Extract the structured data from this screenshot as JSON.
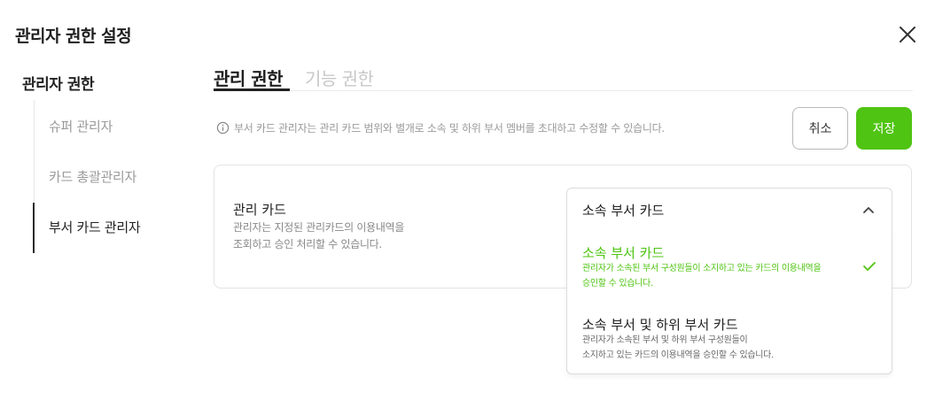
{
  "page": {
    "title": "관리자 권한 설정"
  },
  "sidebar": {
    "title": "관리자 권한",
    "items": [
      {
        "label": "슈퍼 관리자",
        "active": false
      },
      {
        "label": "카드 총괄관리자",
        "active": false
      },
      {
        "label": "부서 카드 관리자",
        "active": true
      }
    ]
  },
  "tabs": [
    {
      "label": "관리 권한",
      "active": true
    },
    {
      "label": "기능 권한",
      "active": false
    }
  ],
  "info": {
    "text": "부서 카드 관리자는 관리 카드 범위와 별개로 소속 및 하위 부서 멤버를 초대하고 수정할 수 있습니다."
  },
  "actions": {
    "cancel_label": "취소",
    "save_label": "저장"
  },
  "card": {
    "title": "관리 카드",
    "desc_line1": "관리자는 지정된 관리카드의 이용내역을",
    "desc_line2": "조회하고 승인 처리할 수 있습니다."
  },
  "select": {
    "value": "소속 부서 카드",
    "options": [
      {
        "title": "소속 부서 카드",
        "desc_line1": "관리자가 소속된 부서 구성원들이 소지하고 있는 카드의 이용내역을",
        "desc_line2": "승인할 수 있습니다.",
        "selected": true
      },
      {
        "title": "소속 부서 및 하위 부서 카드",
        "desc_line1": "관리자가 소속된 부서 및 하위 부서 구성원들이",
        "desc_line2": "소지하고 있는 카드의 이용내역을 승인할 수 있습니다.",
        "selected": false
      }
    ]
  },
  "colors": {
    "accent": "#4fc412",
    "text": "#222222",
    "muted": "#9a9a9a"
  },
  "icons": {
    "close": "close-icon",
    "info": "info-icon",
    "chevron": "chevron-up-icon",
    "check": "check-icon"
  }
}
